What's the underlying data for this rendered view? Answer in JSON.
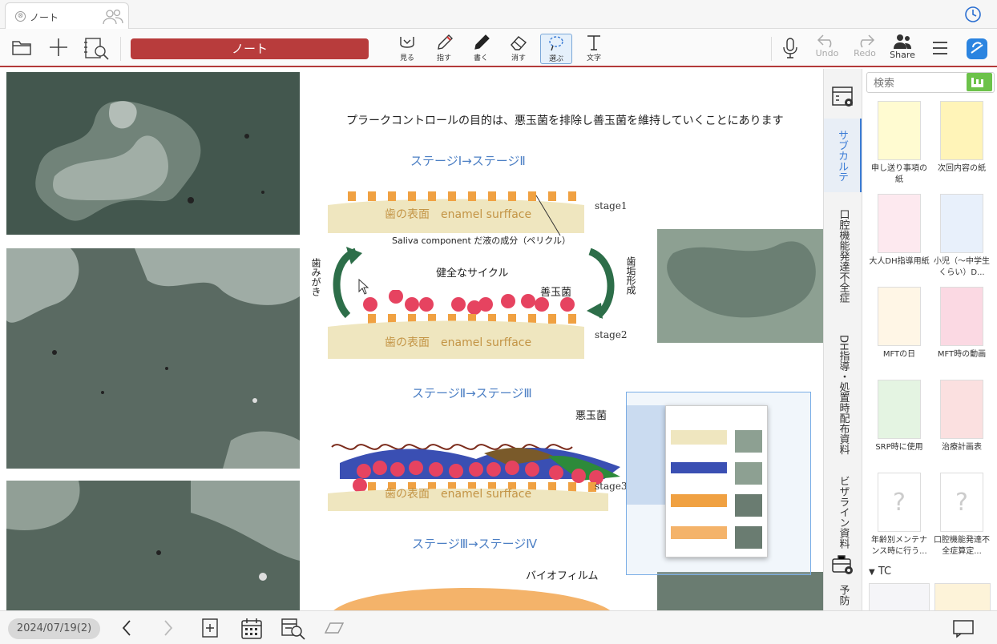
{
  "tab": {
    "title": "ノート",
    "close": "⊗"
  },
  "toolbar": {
    "title_field": "ノート",
    "tools": [
      {
        "id": "view",
        "label": "見る"
      },
      {
        "id": "finger",
        "label": "指す"
      },
      {
        "id": "write",
        "label": "書く"
      },
      {
        "id": "erase",
        "label": "消す"
      },
      {
        "id": "select",
        "label": "選ぶ"
      },
      {
        "id": "text",
        "label": "文字"
      }
    ],
    "undo_label": "Undo",
    "redo_label": "Redo",
    "share_label": "Share",
    "active_tool": "select",
    "accent_color": "#b83c3c"
  },
  "document": {
    "headline": "プラークコントロールの目的は、悪玉菌を排除し善玉菌を維持していくことにあります",
    "stage_heading_1": "ステージⅠ→ステージⅡ",
    "stage_heading_2": "ステージⅡ→ステージⅢ",
    "stage_heading_3": "ステージⅢ→ステージⅣ",
    "tooth_surface_1": "歯の表面　enamel surfface",
    "tooth_surface_2": "歯の表面　enamel surfface",
    "tooth_surface_3": "歯の表面　enamel surfface",
    "stage1": "stage1",
    "stage2": "stage2",
    "stage3": "stage3",
    "saliva": "Saliva component だ液の成分（ペリクル）",
    "healthy_cycle": "健全なサイクル",
    "good_bacteria": "善玉菌",
    "bad_bacteria": "悪玉菌",
    "brushing": "歯みがき",
    "plaque_formation": "歯垢形成",
    "biofilm": "バイオフィルム"
  },
  "side_tabs": [
    {
      "label": "サブカルテ",
      "active": true
    },
    {
      "label": "口腔機能発達不全症",
      "active": false
    },
    {
      "label": "DH指導・処置時配布資料",
      "active": false
    },
    {
      "label": "ビザライン資料",
      "active": false
    },
    {
      "label": "予防",
      "active": false
    }
  ],
  "search": {
    "placeholder": "検索"
  },
  "thumbnails": [
    {
      "label": "申し送り事項の紙"
    },
    {
      "label": "次回内容の紙"
    },
    {
      "label": "大人DH指導用紙"
    },
    {
      "label": "小児（〜中学生くらい）D..."
    },
    {
      "label": "MFTの日"
    },
    {
      "label": "MFT時の動画"
    },
    {
      "label": "SRP時に使用"
    },
    {
      "label": "治療計画表"
    },
    {
      "label": "年齢別メンテナンス時に行う..."
    },
    {
      "label": "口腔機能発達不全症算定..."
    }
  ],
  "section": {
    "label": "TC",
    "arrow": "▼"
  },
  "bottom": {
    "date": "2024/07/19(2)"
  }
}
